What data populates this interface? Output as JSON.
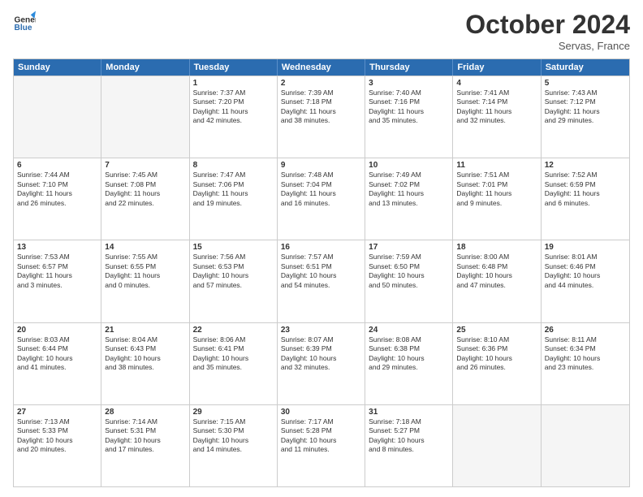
{
  "header": {
    "logo_line1": "General",
    "logo_line2": "Blue",
    "month": "October 2024",
    "location": "Servas, France"
  },
  "weekdays": [
    "Sunday",
    "Monday",
    "Tuesday",
    "Wednesday",
    "Thursday",
    "Friday",
    "Saturday"
  ],
  "rows": [
    [
      {
        "day": "",
        "lines": [],
        "empty": true
      },
      {
        "day": "",
        "lines": [],
        "empty": true
      },
      {
        "day": "1",
        "lines": [
          "Sunrise: 7:37 AM",
          "Sunset: 7:20 PM",
          "Daylight: 11 hours",
          "and 42 minutes."
        ]
      },
      {
        "day": "2",
        "lines": [
          "Sunrise: 7:39 AM",
          "Sunset: 7:18 PM",
          "Daylight: 11 hours",
          "and 38 minutes."
        ]
      },
      {
        "day": "3",
        "lines": [
          "Sunrise: 7:40 AM",
          "Sunset: 7:16 PM",
          "Daylight: 11 hours",
          "and 35 minutes."
        ]
      },
      {
        "day": "4",
        "lines": [
          "Sunrise: 7:41 AM",
          "Sunset: 7:14 PM",
          "Daylight: 11 hours",
          "and 32 minutes."
        ]
      },
      {
        "day": "5",
        "lines": [
          "Sunrise: 7:43 AM",
          "Sunset: 7:12 PM",
          "Daylight: 11 hours",
          "and 29 minutes."
        ]
      }
    ],
    [
      {
        "day": "6",
        "lines": [
          "Sunrise: 7:44 AM",
          "Sunset: 7:10 PM",
          "Daylight: 11 hours",
          "and 26 minutes."
        ]
      },
      {
        "day": "7",
        "lines": [
          "Sunrise: 7:45 AM",
          "Sunset: 7:08 PM",
          "Daylight: 11 hours",
          "and 22 minutes."
        ]
      },
      {
        "day": "8",
        "lines": [
          "Sunrise: 7:47 AM",
          "Sunset: 7:06 PM",
          "Daylight: 11 hours",
          "and 19 minutes."
        ]
      },
      {
        "day": "9",
        "lines": [
          "Sunrise: 7:48 AM",
          "Sunset: 7:04 PM",
          "Daylight: 11 hours",
          "and 16 minutes."
        ]
      },
      {
        "day": "10",
        "lines": [
          "Sunrise: 7:49 AM",
          "Sunset: 7:02 PM",
          "Daylight: 11 hours",
          "and 13 minutes."
        ]
      },
      {
        "day": "11",
        "lines": [
          "Sunrise: 7:51 AM",
          "Sunset: 7:01 PM",
          "Daylight: 11 hours",
          "and 9 minutes."
        ]
      },
      {
        "day": "12",
        "lines": [
          "Sunrise: 7:52 AM",
          "Sunset: 6:59 PM",
          "Daylight: 11 hours",
          "and 6 minutes."
        ]
      }
    ],
    [
      {
        "day": "13",
        "lines": [
          "Sunrise: 7:53 AM",
          "Sunset: 6:57 PM",
          "Daylight: 11 hours",
          "and 3 minutes."
        ]
      },
      {
        "day": "14",
        "lines": [
          "Sunrise: 7:55 AM",
          "Sunset: 6:55 PM",
          "Daylight: 11 hours",
          "and 0 minutes."
        ]
      },
      {
        "day": "15",
        "lines": [
          "Sunrise: 7:56 AM",
          "Sunset: 6:53 PM",
          "Daylight: 10 hours",
          "and 57 minutes."
        ]
      },
      {
        "day": "16",
        "lines": [
          "Sunrise: 7:57 AM",
          "Sunset: 6:51 PM",
          "Daylight: 10 hours",
          "and 54 minutes."
        ]
      },
      {
        "day": "17",
        "lines": [
          "Sunrise: 7:59 AM",
          "Sunset: 6:50 PM",
          "Daylight: 10 hours",
          "and 50 minutes."
        ]
      },
      {
        "day": "18",
        "lines": [
          "Sunrise: 8:00 AM",
          "Sunset: 6:48 PM",
          "Daylight: 10 hours",
          "and 47 minutes."
        ]
      },
      {
        "day": "19",
        "lines": [
          "Sunrise: 8:01 AM",
          "Sunset: 6:46 PM",
          "Daylight: 10 hours",
          "and 44 minutes."
        ]
      }
    ],
    [
      {
        "day": "20",
        "lines": [
          "Sunrise: 8:03 AM",
          "Sunset: 6:44 PM",
          "Daylight: 10 hours",
          "and 41 minutes."
        ]
      },
      {
        "day": "21",
        "lines": [
          "Sunrise: 8:04 AM",
          "Sunset: 6:43 PM",
          "Daylight: 10 hours",
          "and 38 minutes."
        ]
      },
      {
        "day": "22",
        "lines": [
          "Sunrise: 8:06 AM",
          "Sunset: 6:41 PM",
          "Daylight: 10 hours",
          "and 35 minutes."
        ]
      },
      {
        "day": "23",
        "lines": [
          "Sunrise: 8:07 AM",
          "Sunset: 6:39 PM",
          "Daylight: 10 hours",
          "and 32 minutes."
        ]
      },
      {
        "day": "24",
        "lines": [
          "Sunrise: 8:08 AM",
          "Sunset: 6:38 PM",
          "Daylight: 10 hours",
          "and 29 minutes."
        ]
      },
      {
        "day": "25",
        "lines": [
          "Sunrise: 8:10 AM",
          "Sunset: 6:36 PM",
          "Daylight: 10 hours",
          "and 26 minutes."
        ]
      },
      {
        "day": "26",
        "lines": [
          "Sunrise: 8:11 AM",
          "Sunset: 6:34 PM",
          "Daylight: 10 hours",
          "and 23 minutes."
        ]
      }
    ],
    [
      {
        "day": "27",
        "lines": [
          "Sunrise: 7:13 AM",
          "Sunset: 5:33 PM",
          "Daylight: 10 hours",
          "and 20 minutes."
        ]
      },
      {
        "day": "28",
        "lines": [
          "Sunrise: 7:14 AM",
          "Sunset: 5:31 PM",
          "Daylight: 10 hours",
          "and 17 minutes."
        ]
      },
      {
        "day": "29",
        "lines": [
          "Sunrise: 7:15 AM",
          "Sunset: 5:30 PM",
          "Daylight: 10 hours",
          "and 14 minutes."
        ]
      },
      {
        "day": "30",
        "lines": [
          "Sunrise: 7:17 AM",
          "Sunset: 5:28 PM",
          "Daylight: 10 hours",
          "and 11 minutes."
        ]
      },
      {
        "day": "31",
        "lines": [
          "Sunrise: 7:18 AM",
          "Sunset: 5:27 PM",
          "Daylight: 10 hours",
          "and 8 minutes."
        ]
      },
      {
        "day": "",
        "lines": [],
        "empty": true
      },
      {
        "day": "",
        "lines": [],
        "empty": true
      }
    ]
  ]
}
